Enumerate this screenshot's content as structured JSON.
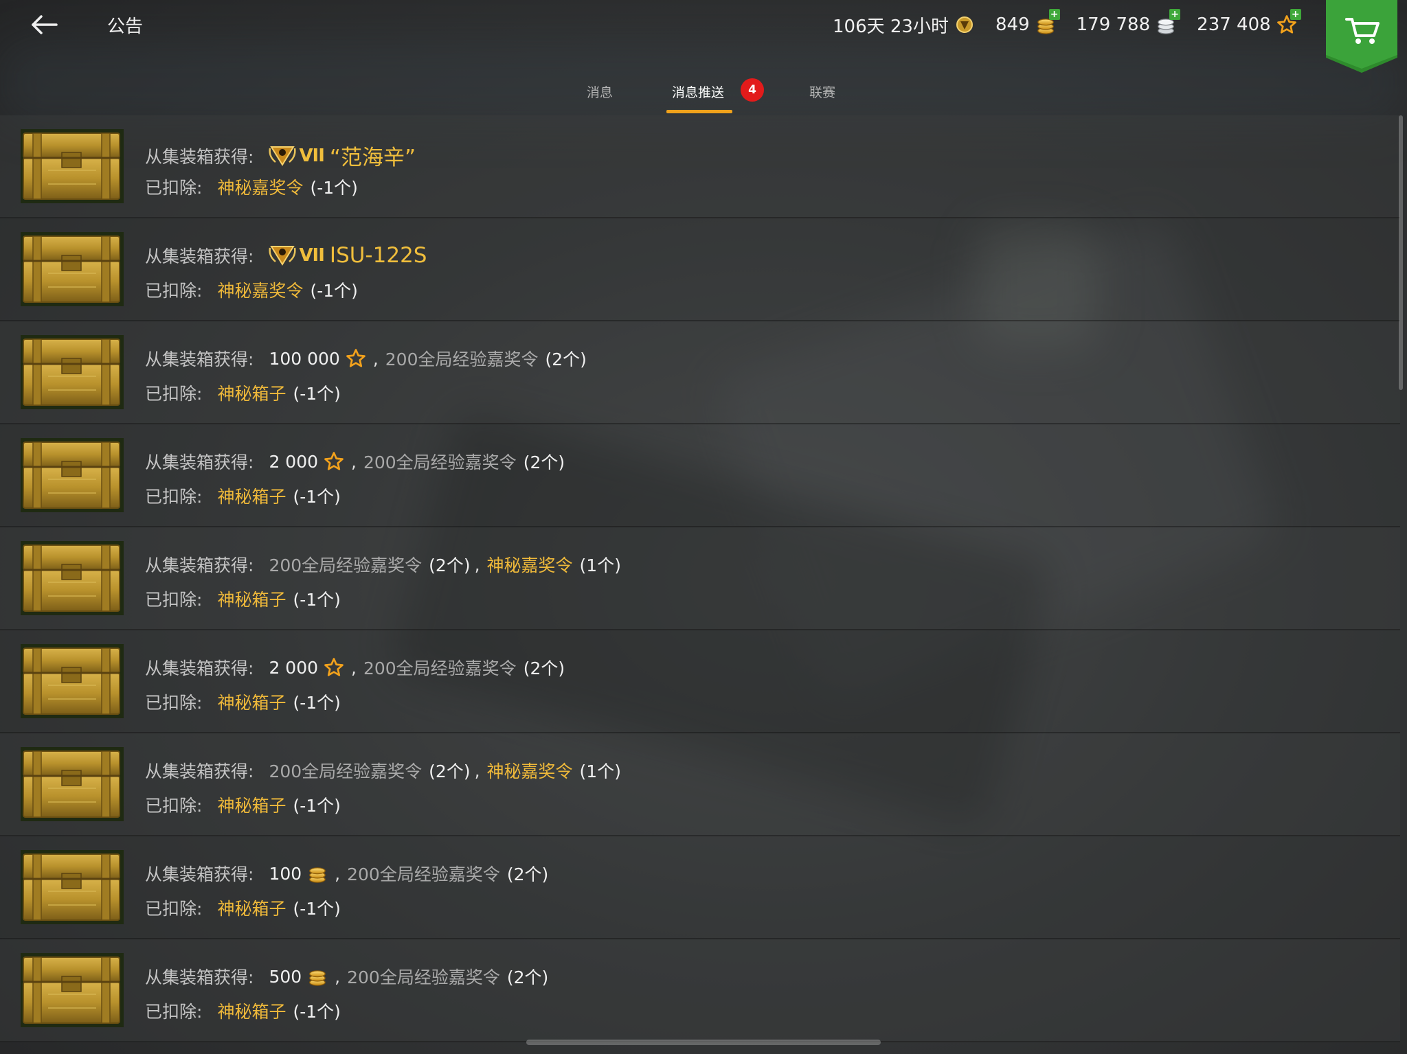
{
  "header": {
    "title": "公告",
    "premium_time": "106天 23小时",
    "gold": "849",
    "silver": "179 788",
    "free_xp": "237 408"
  },
  "tabs": [
    {
      "label": "消息",
      "active": false
    },
    {
      "label": "消息推送",
      "active": true,
      "badge": "4"
    },
    {
      "label": "联赛",
      "active": false
    }
  ],
  "colors": {
    "accent": "#f0a21b",
    "gold_text": "#efb93a",
    "badge_red": "#e21b1b",
    "cart_green": "#2e8b2c"
  },
  "rows": [
    {
      "label": "从集装箱获得:",
      "tier": "VII",
      "reward": "“范海辛”",
      "deducted_label": "已扣除:",
      "deducted_item": "神秘嘉奖令",
      "deducted_qty": "(-1个)"
    },
    {
      "label": "从集装箱获得:",
      "tier": "VII",
      "reward": "ISU-122S",
      "deducted_label": "已扣除:",
      "deducted_item": "神秘嘉奖令",
      "deducted_qty": "(-1个)"
    },
    {
      "label": "从集装箱获得:",
      "amount": "100 000",
      "sep": ",",
      "item": "200全局经验嘉奖令",
      "qty": "(2个)",
      "deducted_label": "已扣除:",
      "deducted_item": "神秘箱子",
      "deducted_qty": "(-1个)"
    },
    {
      "label": "从集装箱获得:",
      "amount": "2 000",
      "sep": ",",
      "item": "200全局经验嘉奖令",
      "qty": "(2个)",
      "deducted_label": "已扣除:",
      "deducted_item": "神秘箱子",
      "deducted_qty": "(-1个)"
    },
    {
      "label": "从集装箱获得:",
      "item": "200全局经验嘉奖令",
      "qty": "(2个)",
      "sep": ",",
      "item2": "神秘嘉奖令",
      "qty2": "(1个)",
      "deducted_label": "已扣除:",
      "deducted_item": "神秘箱子",
      "deducted_qty": "(-1个)"
    },
    {
      "label": "从集装箱获得:",
      "amount": "2 000",
      "sep": ",",
      "item": "200全局经验嘉奖令",
      "qty": "(2个)",
      "deducted_label": "已扣除:",
      "deducted_item": "神秘箱子",
      "deducted_qty": "(-1个)"
    },
    {
      "label": "从集装箱获得:",
      "item": "200全局经验嘉奖令",
      "qty": "(2个)",
      "sep": ",",
      "item2": "神秘嘉奖令",
      "qty2": "(1个)",
      "deducted_label": "已扣除:",
      "deducted_item": "神秘箱子",
      "deducted_qty": "(-1个)"
    },
    {
      "label": "从集装箱获得:",
      "amount": "100",
      "sep": ",",
      "item": "200全局经验嘉奖令",
      "qty": "(2个)",
      "deducted_label": "已扣除:",
      "deducted_item": "神秘箱子",
      "deducted_qty": "(-1个)"
    },
    {
      "label": "从集装箱获得:",
      "amount": "500",
      "sep": ",",
      "item": "200全局经验嘉奖令",
      "qty": "(2个)",
      "deducted_label": "已扣除:",
      "deducted_item": "神秘箱子",
      "deducted_qty": "(-1个)"
    }
  ]
}
